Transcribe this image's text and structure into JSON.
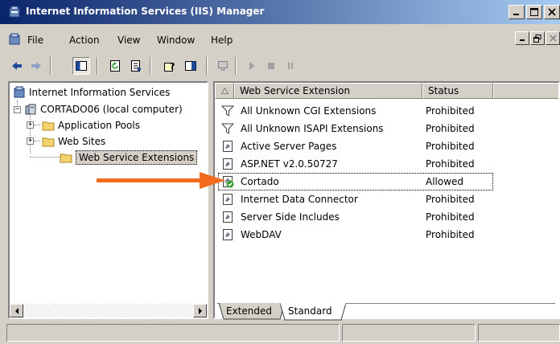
{
  "window": {
    "title": "Internet Information Services (IIS) Manager"
  },
  "menu": {
    "items": [
      "File",
      "Action",
      "View",
      "Window",
      "Help"
    ]
  },
  "toolbar": {
    "buttons": [
      "back-icon",
      "forward-icon",
      "show-hide-console-tree-icon",
      "refresh-icon",
      "export-list-icon",
      "help-icon",
      "show-action-pane-icon",
      "computer-icon",
      "play-icon",
      "stop-icon",
      "pause-icon"
    ]
  },
  "tree": {
    "root": "Internet Information Services",
    "computer": "CORTADO06 (local computer)",
    "items": [
      "Application Pools",
      "Web Sites",
      "Web Service Extensions"
    ],
    "selected": "Web Service Extensions"
  },
  "list": {
    "columns": [
      "Web Service Extension",
      "Status"
    ],
    "rows": [
      {
        "name": "All Unknown CGI Extensions",
        "status": "Prohibited",
        "icon": "filter-icon"
      },
      {
        "name": "All Unknown ISAPI Extensions",
        "status": "Prohibited",
        "icon": "filter-icon"
      },
      {
        "name": "Active Server Pages",
        "status": "Prohibited",
        "icon": "extension-icon"
      },
      {
        "name": "ASP.NET v2.0.50727",
        "status": "Prohibited",
        "icon": "extension-icon"
      },
      {
        "name": "Cortado",
        "status": "Allowed",
        "icon": "allowed-extension-icon"
      },
      {
        "name": "Internet Data Connector",
        "status": "Prohibited",
        "icon": "extension-icon"
      },
      {
        "name": "Server Side Includes",
        "status": "Prohibited",
        "icon": "extension-icon"
      },
      {
        "name": "WebDAV",
        "status": "Prohibited",
        "icon": "extension-icon"
      }
    ]
  },
  "tabs": [
    "Extended",
    "Standard"
  ],
  "active_tab": "Standard",
  "colors": {
    "annotation_arrow": "#f26b1d",
    "title_bar": "#0a246a",
    "allowed_check": "#2e9e2e"
  }
}
